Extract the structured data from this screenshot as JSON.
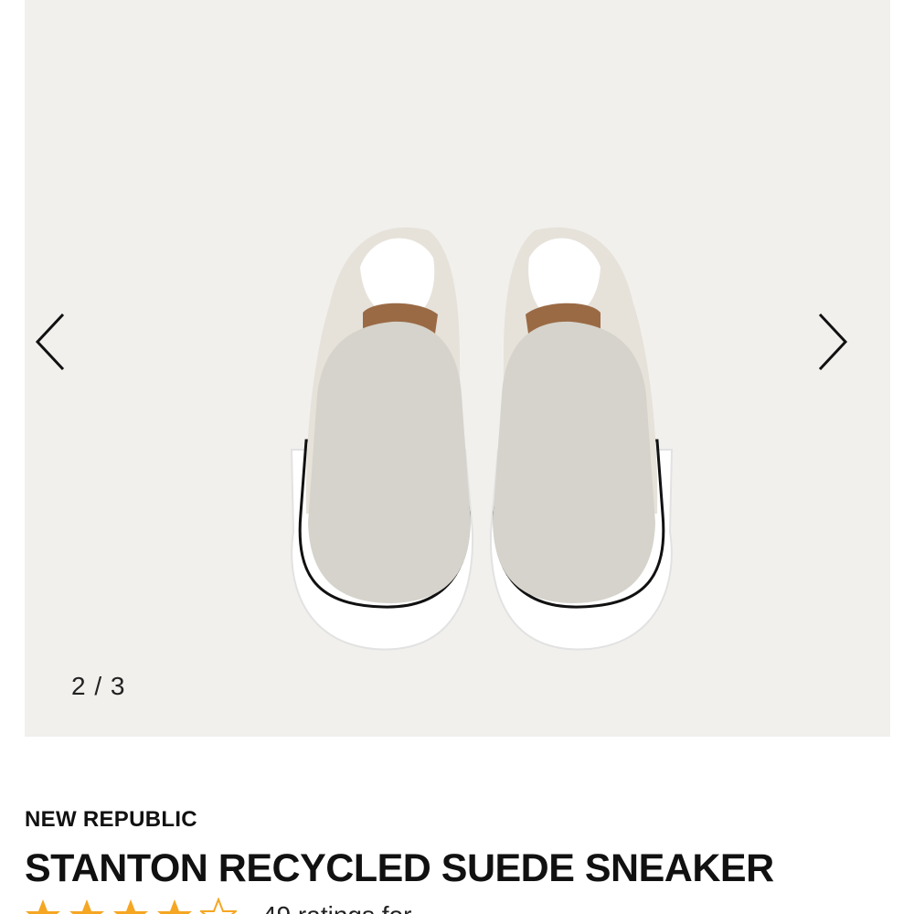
{
  "gallery": {
    "counter": "2 / 3",
    "image_alt": "slip-on sneaker pair, top view",
    "prev_icon": "chevron-left-icon",
    "next_icon": "chevron-right-icon",
    "colors": {
      "background": "#f1f0ed",
      "suede": "#d5d3cb",
      "sole": "#ffffff",
      "insole": "#9a6a45"
    }
  },
  "product": {
    "brand": "NEW REPUBLIC",
    "title": "STANTON RECYCLED SUEDE SNEAKER",
    "rating": 4,
    "rating_max": 5,
    "reviews_text": "49 ratings for ...",
    "star_color": "#f5a623"
  }
}
